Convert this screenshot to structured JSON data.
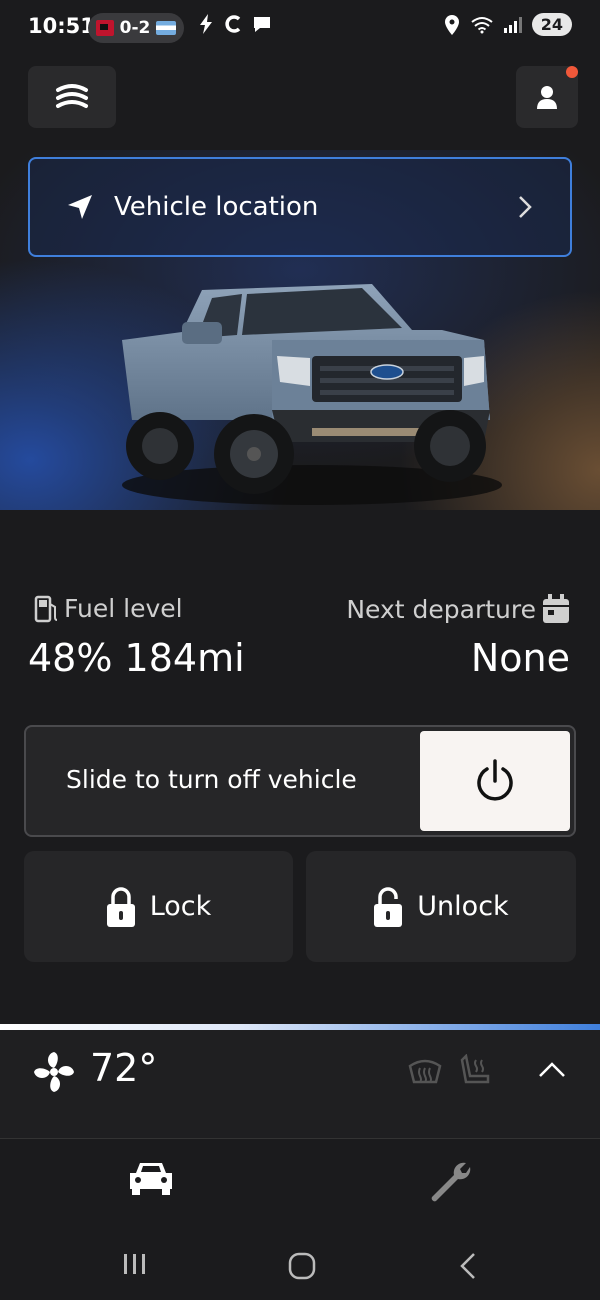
{
  "status_bar": {
    "time": "10:51",
    "score": "0-2",
    "battery": "24"
  },
  "header": {
    "menu_icon": "vehicle-stack-icon",
    "profile_icon": "person-icon",
    "notification_color": "#f0583a"
  },
  "location": {
    "label": "Vehicle location",
    "icon": "navigation-arrow-icon"
  },
  "stats": {
    "fuel_label": "Fuel level",
    "fuel_value": "48% 184mi",
    "departure_label": "Next departure",
    "departure_value": "None"
  },
  "slide": {
    "label": "Slide to turn off vehicle",
    "icon": "power-icon"
  },
  "actions": {
    "lock_label": "Lock",
    "unlock_label": "Unlock"
  },
  "climate": {
    "temperature": "72°",
    "icons": [
      "fan-icon",
      "defrost-icon",
      "heated-seat-icon",
      "chevron-up-icon"
    ]
  },
  "nav": {
    "items": [
      "car-icon",
      "wrench-icon"
    ]
  },
  "colors": {
    "accent": "#3f7fdc",
    "background": "#1b1b1d",
    "card": "#262628"
  }
}
